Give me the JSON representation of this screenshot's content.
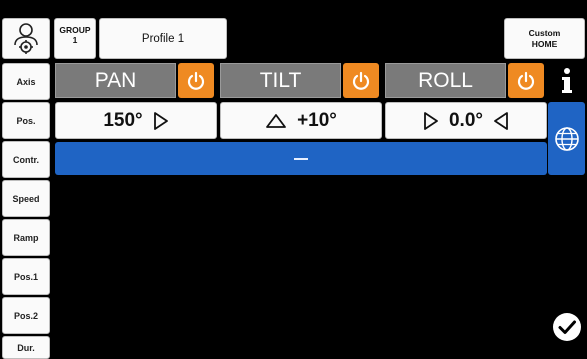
{
  "top": {
    "group_label": "GROUP\n1",
    "profile_label": "Profile 1",
    "custom_home_label": "Custom\nHOME"
  },
  "sidebar": {
    "items": [
      "Axis",
      "Pos.",
      "Contr.",
      "Speed",
      "Ramp",
      "Pos.1",
      "Pos.2",
      "Dur."
    ]
  },
  "axes": {
    "pan": {
      "label": "PAN",
      "value": "150°"
    },
    "tilt": {
      "label": "TILT",
      "value": "+10°"
    },
    "roll": {
      "label": "ROLL",
      "value": "0.0°"
    }
  },
  "colors": {
    "accent_orange": "#ef8a22",
    "header_gray": "#7a7a7a",
    "active_blue": "#1f64c4"
  },
  "icons": [
    "settings-user-icon",
    "power-icon",
    "info-icon",
    "globe-icon",
    "checkmark-icon",
    "triangle-right-icon",
    "triangle-up-icon",
    "triangle-left-icon"
  ]
}
